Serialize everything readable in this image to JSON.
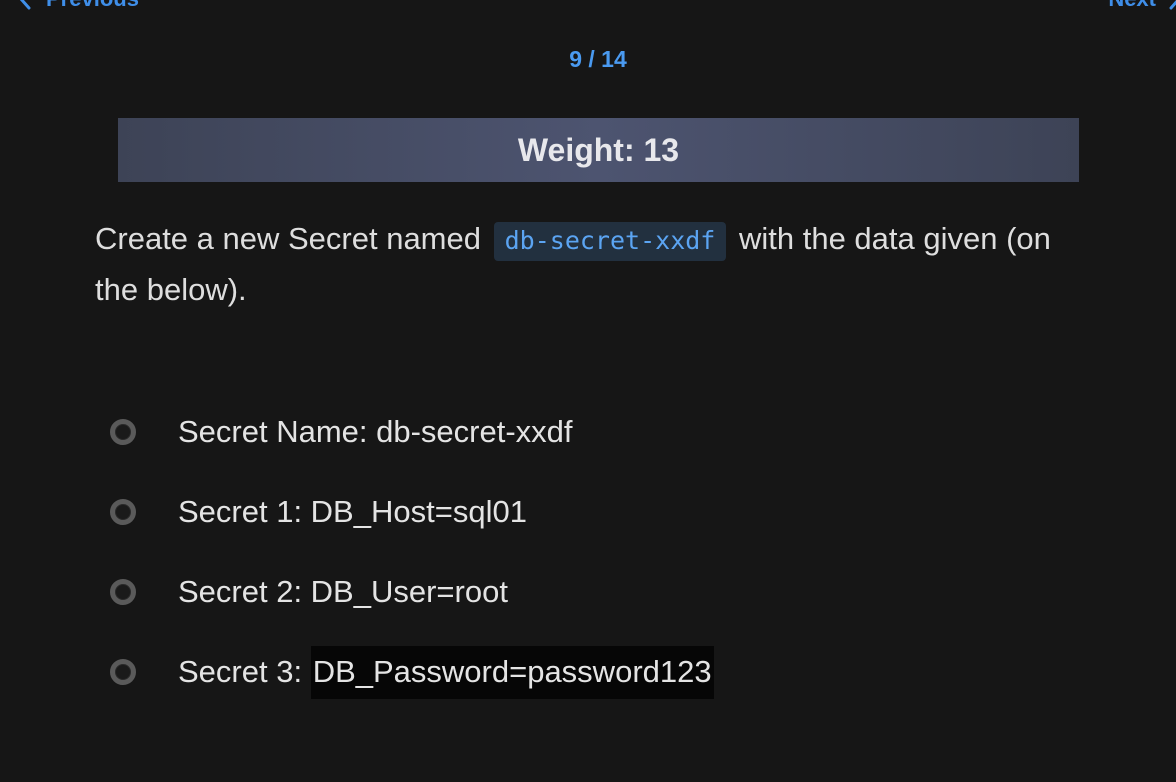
{
  "nav": {
    "prev_label": "Previous",
    "next_label": "Next"
  },
  "counter": "9 / 14",
  "weight_label": "Weight: 13",
  "question": {
    "before": "Create a new Secret named",
    "code": "db-secret-xxdf",
    "after": "with the data given (on the below)."
  },
  "items": [
    {
      "text": "Secret Name: db-secret-xxdf"
    },
    {
      "text": "Secret 1: DB_Host=sql01"
    },
    {
      "text": "Secret 2: DB_User=root"
    },
    {
      "prefix": "Secret 3: ",
      "highlighted": "DB_Password=password123"
    }
  ],
  "colors": {
    "background": "#161616",
    "accent": "#3f8ee8",
    "weight_bar": "#474d66",
    "code_text": "#5ba4f2",
    "code_background": "#22303f"
  }
}
